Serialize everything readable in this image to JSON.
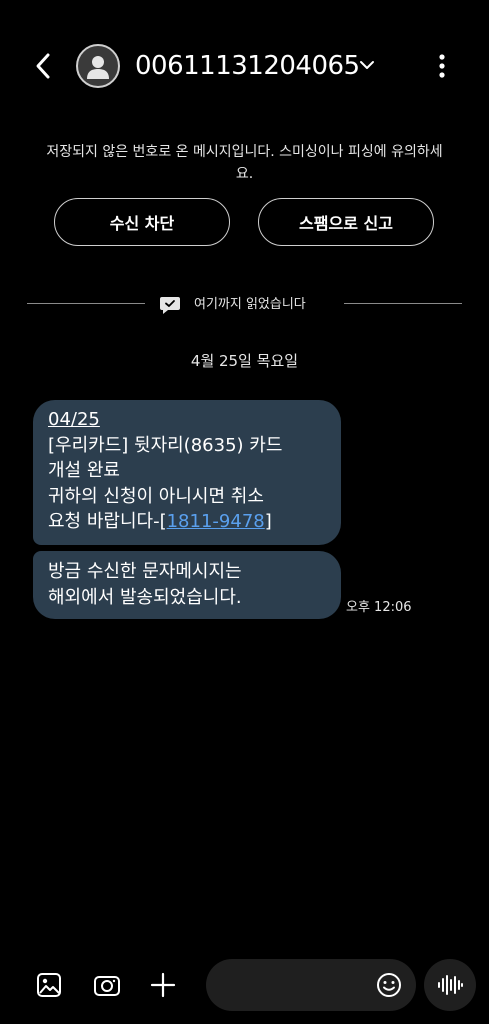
{
  "header": {
    "contact_number": "00611131204065"
  },
  "notice": {
    "warning_text": "저장되지 않은 번호로 온 메시지입니다. 스미싱이나 피싱에 유의하세요.",
    "block_label": "수신 차단",
    "report_spam_label": "스팸으로 신고"
  },
  "thread": {
    "read_divider_label": "여기까지 읽었습니다",
    "date_label": "4월 25일 목요일",
    "messages": [
      {
        "lines": [
          "04/25",
          "[우리카드] 뒷자리(8635) 카드",
          "개설 완료",
          "귀하의 신청이 아니시면 취소",
          "요청 바랍니다-["
        ],
        "phone": "1811-9478",
        "closing": "]"
      },
      {
        "lines": [
          "방금 수신한 문자메시지는",
          "해외에서 발송되었습니다."
        ],
        "time": "오후 12:06"
      }
    ]
  },
  "composer": {
    "placeholder": ""
  },
  "icons": {
    "back": "back-arrow-icon",
    "avatar": "person-icon",
    "dropdown": "chevron-down-icon",
    "more": "more-vertical-icon",
    "read": "chat-check-icon",
    "gallery": "gallery-icon",
    "camera": "camera-icon",
    "add": "plus-icon",
    "emoji": "emoji-icon",
    "voice": "voice-wave-icon"
  },
  "colors": {
    "background": "#000000",
    "bubble": "#2c3e4e",
    "link": "#5aa0ee",
    "input_bg": "#1f1f1f"
  }
}
